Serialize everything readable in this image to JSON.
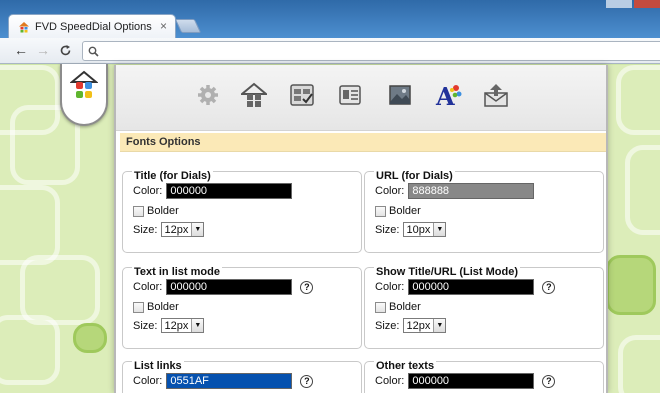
{
  "browser": {
    "tab_title": "FVD SpeedDial Options",
    "tab_close": "×",
    "back": "←",
    "forward": "→",
    "reload": "C",
    "search_icon": "search-icon"
  },
  "toolbar_icons": [
    "gear-icon",
    "home-icon",
    "dials-icon",
    "checklist-icon",
    "import-icon",
    "image-icon",
    "fonts-icon",
    "mail-icon"
  ],
  "section": {
    "title": "Fonts Options"
  },
  "labels": {
    "color": "Color:",
    "bolder": "Bolder",
    "size": "Size:",
    "help": "?"
  },
  "groups": [
    {
      "title": "Title (for Dials)",
      "color": "000000",
      "size": "12px"
    },
    {
      "title": "URL (for Dials)",
      "color": "888888",
      "size": "10px"
    },
    {
      "title": "Text in list mode",
      "color": "000000",
      "size": "12px"
    },
    {
      "title": "Show Title/URL (List Mode)",
      "color": "000000",
      "size": "12px"
    },
    {
      "title": "List links",
      "color": "0551AF"
    },
    {
      "title": "Other texts",
      "color": "000000"
    }
  ],
  "colors": {
    "accent": "#fbe9b7",
    "bg": "#dcedb9"
  }
}
